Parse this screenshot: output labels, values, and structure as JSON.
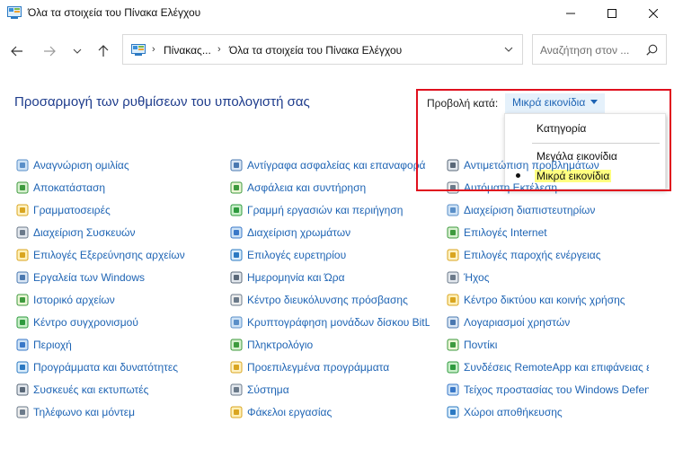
{
  "window": {
    "title": "Όλα τα στοιχεία του Πίνακα Ελέγχου"
  },
  "address": {
    "crumbs": [
      "Πίνακας...",
      "Όλα τα στοιχεία του Πίνακα Ελέγχου"
    ],
    "search_placeholder": "Αναζήτηση στον ..."
  },
  "heading": "Προσαρμογή των ρυθμίσεων του υπολογιστή σας",
  "viewby": {
    "label": "Προβολή κατά:",
    "selected": "Μικρά εικονίδια",
    "options": [
      "Κατηγορία",
      "Μεγάλα εικονίδια",
      "Μικρά εικονίδια"
    ]
  },
  "items": {
    "col0": [
      "Αναγνώριση ομιλίας",
      "Αποκατάσταση",
      "Γραμματοσειρές",
      "Διαχείριση Συσκευών",
      "Επιλογές Εξερεύνησης αρχείων",
      "Εργαλεία των Windows",
      "Ιστορικό αρχείων",
      "Κέντρο συγχρονισμού",
      "Περιοχή",
      "Προγράμματα και δυνατότητες",
      "Συσκευές και εκτυπωτές",
      "Τηλέφωνο και μόντεμ"
    ],
    "col1": [
      "Αντίγραφα ασφαλείας και επαναφορά",
      "Ασφάλεια και συντήρηση",
      "Γραμμή εργασιών και περιήγηση",
      "Διαχείριση χρωμάτων",
      "Επιλογές ευρετηρίου",
      "Ημερομηνία και Ώρα",
      "Κέντρο διευκόλυνσης πρόσβασης",
      "Κρυπτογράφηση μονάδων δίσκου BitLocker",
      "Πληκτρολόγιο",
      "Προεπιλεγμένα προγράμματα",
      "Σύστημα",
      "Φάκελοι εργασίας"
    ],
    "col2": [
      "Αντιμετώπιση προβλημάτων",
      "Αυτόματη Εκτέλεση",
      "Διαχείριση διαπιστευτηρίων",
      "Επιλογές Internet",
      "Επιλογές παροχής ενέργειας",
      "Ήχος",
      "Κέντρο δικτύου και κοινής χρήσης",
      "Λογαριασμοί χρηστών",
      "Ποντίκι",
      "Συνδέσεις RemoteApp και επιφάνειας εργασίας",
      "Τείχος προστασίας του Windows Defender",
      "Χώροι αποθήκευσης"
    ]
  },
  "colors": {
    "link": "#1e64b4",
    "heading": "#1e3c8c",
    "highlight": "#ffff80",
    "frame": "#e0101e"
  }
}
